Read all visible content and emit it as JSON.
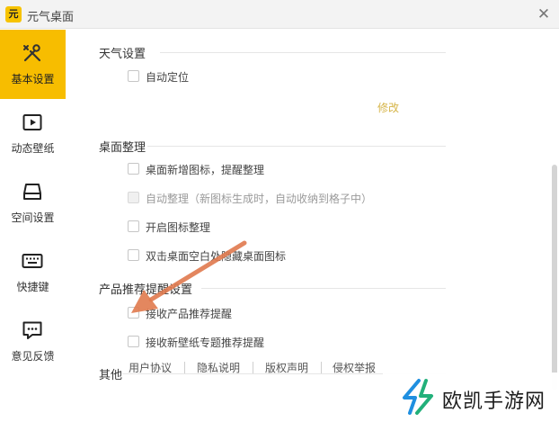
{
  "window": {
    "logo_text": "元",
    "title": "元气桌面",
    "close_symbol": "✕"
  },
  "sidebar": {
    "items": [
      {
        "label": "基本设置",
        "icon": "tools-icon",
        "active": true
      },
      {
        "label": "动态壁纸",
        "icon": "play-icon",
        "active": false
      },
      {
        "label": "空间设置",
        "icon": "drive-icon",
        "active": false
      },
      {
        "label": "快捷键",
        "icon": "keyboard-icon",
        "active": false
      },
      {
        "label": "意见反馈",
        "icon": "feedback-icon",
        "active": false
      }
    ]
  },
  "sections": {
    "weather": {
      "title": "天气设置",
      "options": [
        {
          "label": "自动定位",
          "checked": false,
          "disabled": false
        }
      ],
      "edit_label": "修改"
    },
    "desktop": {
      "title": "桌面整理",
      "options": [
        {
          "label": "桌面新增图标，提醒整理",
          "checked": false,
          "disabled": false
        },
        {
          "label": "自动整理（新图标生成时，自动收纳到格子中）",
          "checked": false,
          "disabled": true
        },
        {
          "label": "开启图标整理",
          "checked": false,
          "disabled": false
        },
        {
          "label": "双击桌面空白处隐藏桌面图标",
          "checked": false,
          "disabled": false
        }
      ]
    },
    "recommend": {
      "title": "产品推荐提醒设置",
      "options": [
        {
          "label": "接收产品推荐提醒",
          "checked": false,
          "disabled": false
        },
        {
          "label": "接收新壁纸专题推荐提醒",
          "checked": false,
          "disabled": false
        }
      ]
    },
    "other": {
      "title": "其他",
      "links": [
        "用户协议",
        "隐私说明",
        "版权声明",
        "侵权举报"
      ]
    }
  },
  "watermark": {
    "text": "欧凯手游网"
  },
  "colors": {
    "accent": "#f7bd00",
    "edit_link": "#d6b54a",
    "arrow": "#e07a4e"
  }
}
